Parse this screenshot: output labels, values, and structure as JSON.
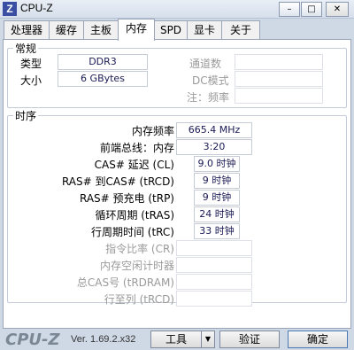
{
  "window": {
    "title": "CPU-Z",
    "icon_glyph": "Z",
    "min_glyph": "–",
    "max_glyph": "□",
    "close_glyph": "✕"
  },
  "tabs": [
    "处理器",
    "缓存",
    "主板",
    "内存",
    "SPD",
    "显卡",
    "关于"
  ],
  "active_tab": "内存",
  "general": {
    "title": "常规",
    "type_label": "类型",
    "type_value": "DDR3",
    "size_label": "大小",
    "size_value": "6 GBytes",
    "channels_label": "通道数",
    "channels_value": "",
    "dc_mode_label": "DC模式",
    "dc_mode_value": "",
    "nb_freq_label": "注：频率",
    "nb_freq_value": ""
  },
  "timings": {
    "title": "时序",
    "rows": [
      {
        "label": "内存频率",
        "value": "665.4 MHz",
        "enabled": true
      },
      {
        "label": "前端总线：内存",
        "value": "3:20",
        "enabled": true
      },
      {
        "label": "CAS# 延迟 (CL)",
        "value": "9.0 时钟",
        "enabled": true
      },
      {
        "label": "RAS# 到CAS# (tRCD)",
        "value": "9 时钟",
        "enabled": true
      },
      {
        "label": "RAS# 预充电 (tRP)",
        "value": "9 时钟",
        "enabled": true
      },
      {
        "label": "循环周期 (tRAS)",
        "value": "24 时钟",
        "enabled": true
      },
      {
        "label": "行周期时间 (tRC)",
        "value": "33 时钟",
        "enabled": true
      },
      {
        "label": "指令比率 (CR)",
        "value": "",
        "enabled": false
      },
      {
        "label": "内存空闲计时器",
        "value": "",
        "enabled": false
      },
      {
        "label": "总CAS号 (tRDRAM)",
        "value": "",
        "enabled": false
      },
      {
        "label": "行至列 (tRCD)",
        "value": "",
        "enabled": false
      }
    ]
  },
  "footer": {
    "brand": "CPU-Z",
    "version": "Ver. 1.69.2.x32",
    "tools_label": "工具",
    "tools_arrow": "▼",
    "validate_label": "验证",
    "ok_label": "确定"
  }
}
